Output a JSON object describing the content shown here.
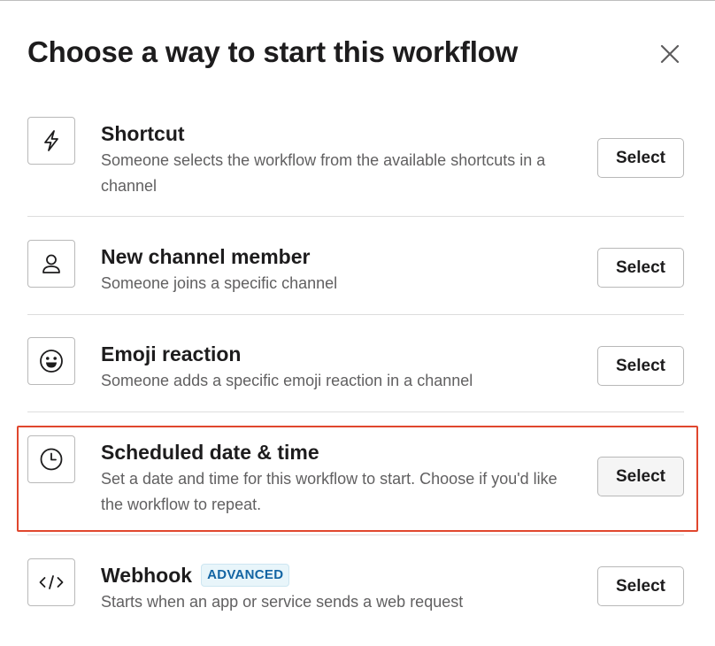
{
  "dialog": {
    "title": "Choose a way to start this workflow",
    "close_icon": "close-icon"
  },
  "options": [
    {
      "icon": "lightning-bolt-icon",
      "title": "Shortcut",
      "description": "Someone selects the workflow from the available shortcuts in a channel",
      "button_label": "Select"
    },
    {
      "icon": "person-icon",
      "title": "New channel member",
      "description": "Someone joins a specific channel",
      "button_label": "Select"
    },
    {
      "icon": "emoji-smile-icon",
      "title": "Emoji reaction",
      "description": "Someone adds a specific emoji reaction in a channel",
      "button_label": "Select"
    },
    {
      "icon": "clock-icon",
      "title": "Scheduled date & time",
      "description": "Set a date and time for this workflow to start. Choose if you'd like the workflow to repeat.",
      "button_label": "Select",
      "highlighted": true
    },
    {
      "icon": "code-icon",
      "title": "Webhook",
      "badge": "ADVANCED",
      "description": "Starts when an app or service sends a web request",
      "button_label": "Select"
    }
  ],
  "colors": {
    "highlight_border": "#e0472e",
    "badge_text": "#1264a3",
    "badge_bg": "#e8f5fa"
  }
}
